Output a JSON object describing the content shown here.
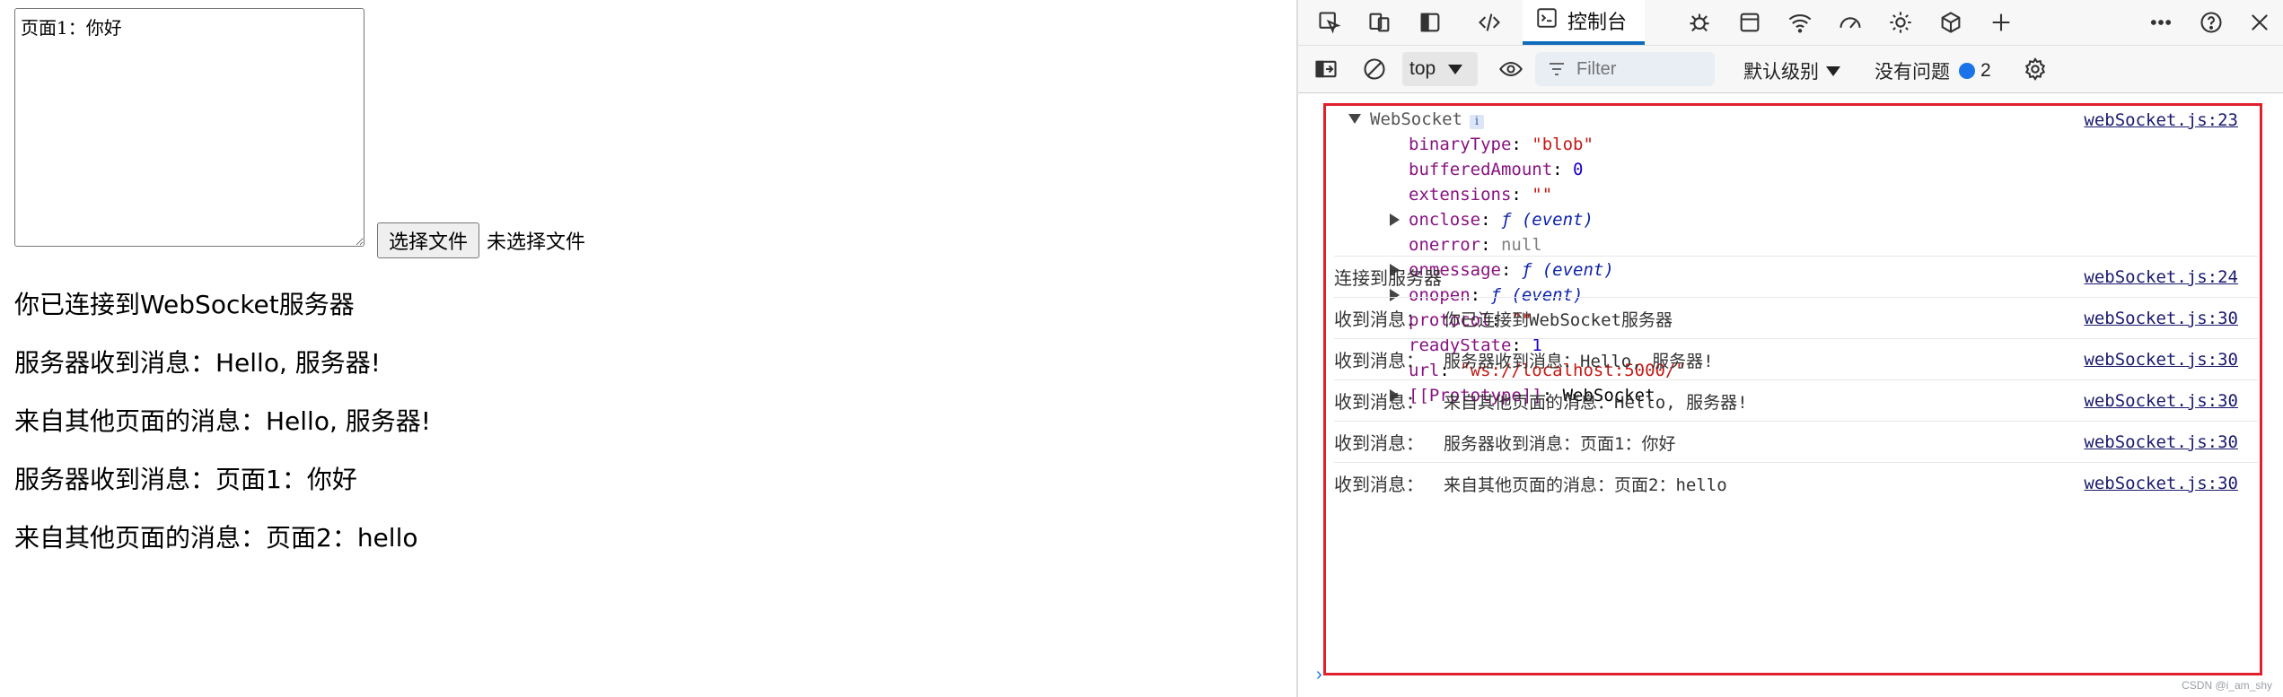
{
  "page": {
    "textarea_value": "页面1：你好",
    "choose_file_label": "选择文件",
    "no_file_text": "未选择文件",
    "messages": [
      "你已连接到WebSocket服务器",
      "服务器收到消息：Hello, 服务器!",
      "来自其他页面的消息：Hello, 服务器!",
      "服务器收到消息：页面1：你好",
      "来自其他页面的消息：页面2：hello"
    ]
  },
  "devtools": {
    "tabs": {
      "console_label": "控制台"
    },
    "toolbar_icons": [
      "inspect-icon",
      "device-emulation-icon",
      "sidebar-icon",
      "elements-icon",
      "console-icon",
      "sources-icon",
      "application-icon",
      "network-icon",
      "performance-icon",
      "memory-icon",
      "3d-view-icon",
      "add-tab-icon",
      "more-icon",
      "help-icon",
      "close-icon"
    ],
    "filterbar": {
      "context": "top",
      "filter_placeholder": "Filter",
      "level_label": "默认级别",
      "issues_label": "没有问题",
      "issues_count": "2"
    },
    "ws_object": {
      "title": "WebSocket",
      "info_badge": "i",
      "source": "webSocket.js:23",
      "props": [
        {
          "key": "binaryType",
          "value": "\"blob\"",
          "kind": "str",
          "expandable": false
        },
        {
          "key": "bufferedAmount",
          "value": "0",
          "kind": "num",
          "expandable": false
        },
        {
          "key": "extensions",
          "value": "\"\"",
          "kind": "str",
          "expandable": false
        },
        {
          "key": "onclose",
          "value": "ƒ (event)",
          "kind": "fn",
          "expandable": true
        },
        {
          "key": "onerror",
          "value": "null",
          "kind": "null",
          "expandable": false
        },
        {
          "key": "onmessage",
          "value": "ƒ (event)",
          "kind": "fn",
          "expandable": true
        },
        {
          "key": "onopen",
          "value": "ƒ (event)",
          "kind": "fn",
          "expandable": true
        },
        {
          "key": "protocol",
          "value": "\"\"",
          "kind": "str",
          "expandable": false
        },
        {
          "key": "readyState",
          "value": "1",
          "kind": "num",
          "expandable": false
        },
        {
          "key": "url",
          "value": "\"ws://localhost:5000/\"",
          "kind": "str",
          "expandable": false
        },
        {
          "key": "[[Prototype]]",
          "value": "WebSocket",
          "kind": "plain",
          "expandable": true
        }
      ]
    },
    "logs": [
      {
        "prefix": "连接到服务器",
        "body": "",
        "source": "webSocket.js:24"
      },
      {
        "prefix": "收到消息：",
        "body": "你已连接到WebSocket服务器",
        "source": "webSocket.js:30"
      },
      {
        "prefix": "收到消息：",
        "body": "服务器收到消息：Hello, 服务器!",
        "source": "webSocket.js:30"
      },
      {
        "prefix": "收到消息：",
        "body": "来自其他页面的消息：Hello, 服务器!",
        "source": "webSocket.js:30"
      },
      {
        "prefix": "收到消息：",
        "body": "服务器收到消息：页面1：你好",
        "source": "webSocket.js:30"
      },
      {
        "prefix": "收到消息：",
        "body": "来自其他页面的消息：页面2：hello",
        "source": "webSocket.js:30"
      }
    ],
    "prompt": "›",
    "watermark": "CSDN @i_am_shy"
  },
  "colors": {
    "highlight": "#e0202c",
    "accent": "#0f6cbd"
  }
}
